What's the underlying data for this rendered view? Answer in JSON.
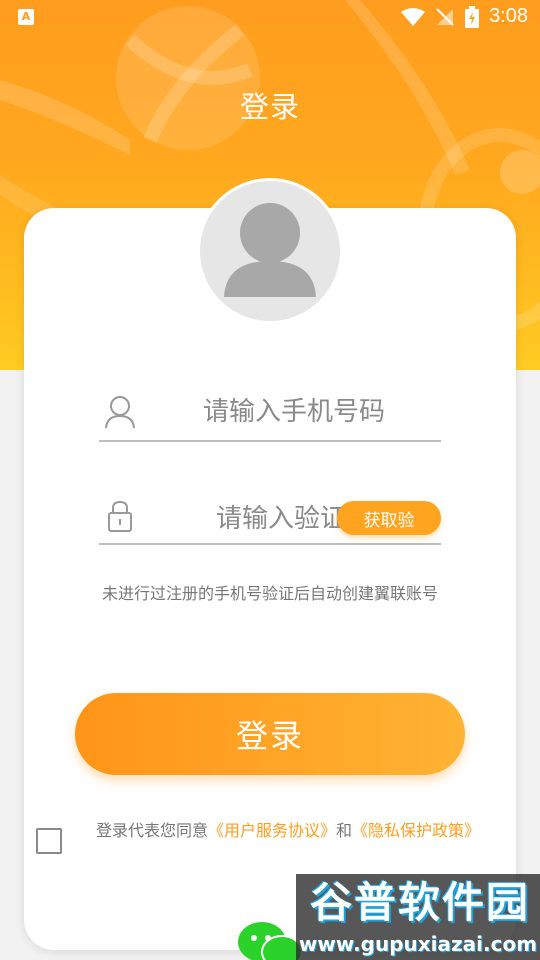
{
  "status_bar": {
    "app_icon_letter": "A",
    "time": "3:08"
  },
  "header": {
    "title": "登录"
  },
  "form": {
    "phone_placeholder": "请输入手机号码",
    "code_placeholder": "请输入验证码",
    "get_code_label": "获取验"
  },
  "hint_text": "未进行过注册的手机号验证后自动创建翼联账号",
  "login_button_label": "登录",
  "agreement": {
    "prefix": "登录代表您同意",
    "terms_link": "《用户服务协议》",
    "conjunction": "和",
    "privacy_link": "《隐私保护政策》"
  },
  "watermark": {
    "title": "谷普软件园",
    "url": "www.gupuxiazai.com"
  },
  "colors": {
    "accent": "#ff9d1e",
    "accent_light": "#ffcb22",
    "text_gray": "#777777"
  }
}
